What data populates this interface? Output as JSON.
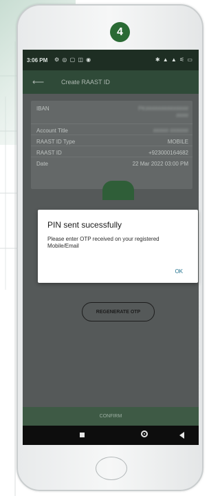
{
  "step_badge": "4",
  "status_bar": {
    "time": "3:06 PM",
    "left_icons": "⚙ ◎ ▢ ◫ ◉",
    "right_icons": "✱ ▲ ▲ ⚟ ▭"
  },
  "app_bar": {
    "back_icon": "arrow-left-icon",
    "title": "Create RAAST ID"
  },
  "details": {
    "rows": [
      {
        "label": "IBAN",
        "value": "PK##############\n####"
      },
      {
        "label": "Account Title",
        "value": "##### ######"
      },
      {
        "label": "RAAST ID Type",
        "value": "MOBILE"
      },
      {
        "label": "RAAST ID",
        "value": "+923000164682"
      },
      {
        "label": "Date",
        "value": "22 Mar 2022 03:00 PM"
      }
    ]
  },
  "dialog": {
    "title": "PIN sent sucessfully",
    "message": "Please enter OTP received on your registered Mobile/Email",
    "ok_label": "OK"
  },
  "regenerate_label": "REGENERATE OTP",
  "confirm_label": "CONFIRM",
  "nav": {
    "recent_icon": "square-icon",
    "home_icon": "circle-icon",
    "back_icon": "triangle-back-icon"
  },
  "colors": {
    "brand_green": "#2a6a34",
    "status_bar": "#1e2e23",
    "dialog_ok": "#1d6f8c"
  }
}
